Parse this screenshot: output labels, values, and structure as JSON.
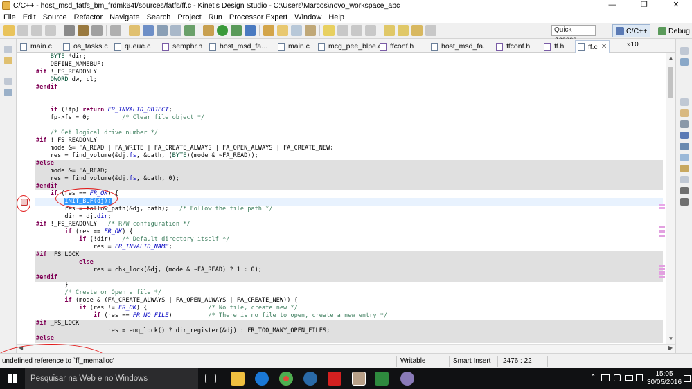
{
  "window": {
    "title": "C/C++ - host_msd_fatfs_bm_frdmk64f/sources/fatfs/ff.c - Kinetis Design Studio - C:\\Users\\Marcos\\novo_workspace_abc",
    "controls": [
      "—",
      "❐",
      "✕"
    ]
  },
  "menu": [
    "File",
    "Edit",
    "Source",
    "Refactor",
    "Navigate",
    "Search",
    "Project",
    "Run",
    "Processor Expert",
    "Window",
    "Help"
  ],
  "toolbar": {
    "quick_access_placeholder": "Quick Access",
    "perspective_cc": "C/C++",
    "perspective_debug": "Debug"
  },
  "tabs": [
    {
      "label": "main.c",
      "kind": "c"
    },
    {
      "label": "os_tasks.c",
      "kind": "c"
    },
    {
      "label": "queue.c",
      "kind": "c"
    },
    {
      "label": "semphr.h",
      "kind": "h"
    },
    {
      "label": "host_msd_fa...",
      "kind": "c"
    },
    {
      "label": "main.c",
      "kind": "c"
    },
    {
      "label": "mcg_pee_blpe.c",
      "kind": "c"
    },
    {
      "label": "ffconf.h",
      "kind": "h"
    },
    {
      "label": "host_msd_fa...",
      "kind": "c"
    },
    {
      "label": "ffconf.h",
      "kind": "h"
    },
    {
      "label": "ff.h",
      "kind": "h"
    },
    {
      "label": "ff.c",
      "kind": "c",
      "active": true,
      "close": "✕"
    }
  ],
  "tab_overflow": "»10",
  "code_lines": [
    {
      "text": "    BYTE *dir;",
      "type": "normal"
    },
    {
      "text": "    DEFINE_NAMEBUF;",
      "type": "normal"
    },
    {
      "text": "#if !_FS_READONLY",
      "type": "normal"
    },
    {
      "text": "    DWORD dw, cl;",
      "type": "normal"
    },
    {
      "text": "#endif",
      "type": "normal"
    },
    {
      "text": "",
      "type": "normal"
    },
    {
      "text": "",
      "type": "normal"
    },
    {
      "text": "    if (!fp) return FR_INVALID_OBJECT;",
      "type": "normal"
    },
    {
      "text": "    fp->fs = 0;         /* Clear file object */",
      "type": "normal"
    },
    {
      "text": "",
      "type": "normal"
    },
    {
      "text": "    /* Get logical drive number */",
      "type": "normal"
    },
    {
      "text": "#if !_FS_READONLY",
      "type": "normal"
    },
    {
      "text": "    mode &= FA_READ | FA_WRITE | FA_CREATE_ALWAYS | FA_OPEN_ALWAYS | FA_CREATE_NEW;",
      "type": "normal"
    },
    {
      "text": "    res = find_volume(&dj.fs, &path, (BYTE)(mode & ~FA_READ));",
      "type": "normal"
    },
    {
      "text": "#else",
      "type": "inactive"
    },
    {
      "text": "    mode &= FA_READ;",
      "type": "inactive"
    },
    {
      "text": "    res = find_volume(&dj.fs, &path, 0);",
      "type": "inactive"
    },
    {
      "text": "#endif",
      "type": "inactive"
    },
    {
      "text": "    if (res == FR_OK) {",
      "type": "normal"
    },
    {
      "text": "        INIT_BUF(dj);",
      "type": "current"
    },
    {
      "text": "        res = follow_path(&dj, path);   /* Follow the file path */",
      "type": "normal"
    },
    {
      "text": "        dir = dj.dir;",
      "type": "normal"
    },
    {
      "text": "#if !_FS_READONLY   /* R/W configuration */",
      "type": "normal"
    },
    {
      "text": "        if (res == FR_OK) {",
      "type": "normal"
    },
    {
      "text": "            if (!dir)   /* Default directory itself */",
      "type": "normal"
    },
    {
      "text": "                res = FR_INVALID_NAME;",
      "type": "normal"
    },
    {
      "text": "#if _FS_LOCK",
      "type": "inactive"
    },
    {
      "text": "            else",
      "type": "inactive"
    },
    {
      "text": "                res = chk_lock(&dj, (mode & ~FA_READ) ? 1 : 0);",
      "type": "inactive"
    },
    {
      "text": "#endif",
      "type": "inactive"
    },
    {
      "text": "        }",
      "type": "normal"
    },
    {
      "text": "        /* Create or Open a file */",
      "type": "normal"
    },
    {
      "text": "        if (mode & (FA_CREATE_ALWAYS | FA_OPEN_ALWAYS | FA_CREATE_NEW)) {",
      "type": "normal"
    },
    {
      "text": "            if (res != FR_OK) {                 /* No file, create new */",
      "type": "normal"
    },
    {
      "text": "                if (res == FR_NO_FILE)          /* There is no file to open, create a new entry */",
      "type": "normal"
    },
    {
      "text": "#if _FS_LOCK",
      "type": "inactive"
    },
    {
      "text": "                    res = enq_lock() ? dir_register(&dj) : FR_TOO_MANY_OPEN_FILES;",
      "type": "inactive"
    },
    {
      "text": "#else",
      "type": "inactive"
    }
  ],
  "status": {
    "message": "undefined reference to `ff_memalloc'",
    "mode": "Writable",
    "insert": "Smart Insert",
    "position": "2476 : 22"
  },
  "taskbar": {
    "search_placeholder": "Pesquisar na Web e no Windows",
    "time": "15:05",
    "date": "30/05/2016"
  },
  "colors": {
    "annotation": "#e21b1b",
    "inactive_code_bg": "#e0e0e0",
    "current_line_bg": "#e8f2fe",
    "selection": "#3399ff",
    "keyword": "#7f0055",
    "comment": "#3f7f5f",
    "macro": "#0000c0"
  }
}
